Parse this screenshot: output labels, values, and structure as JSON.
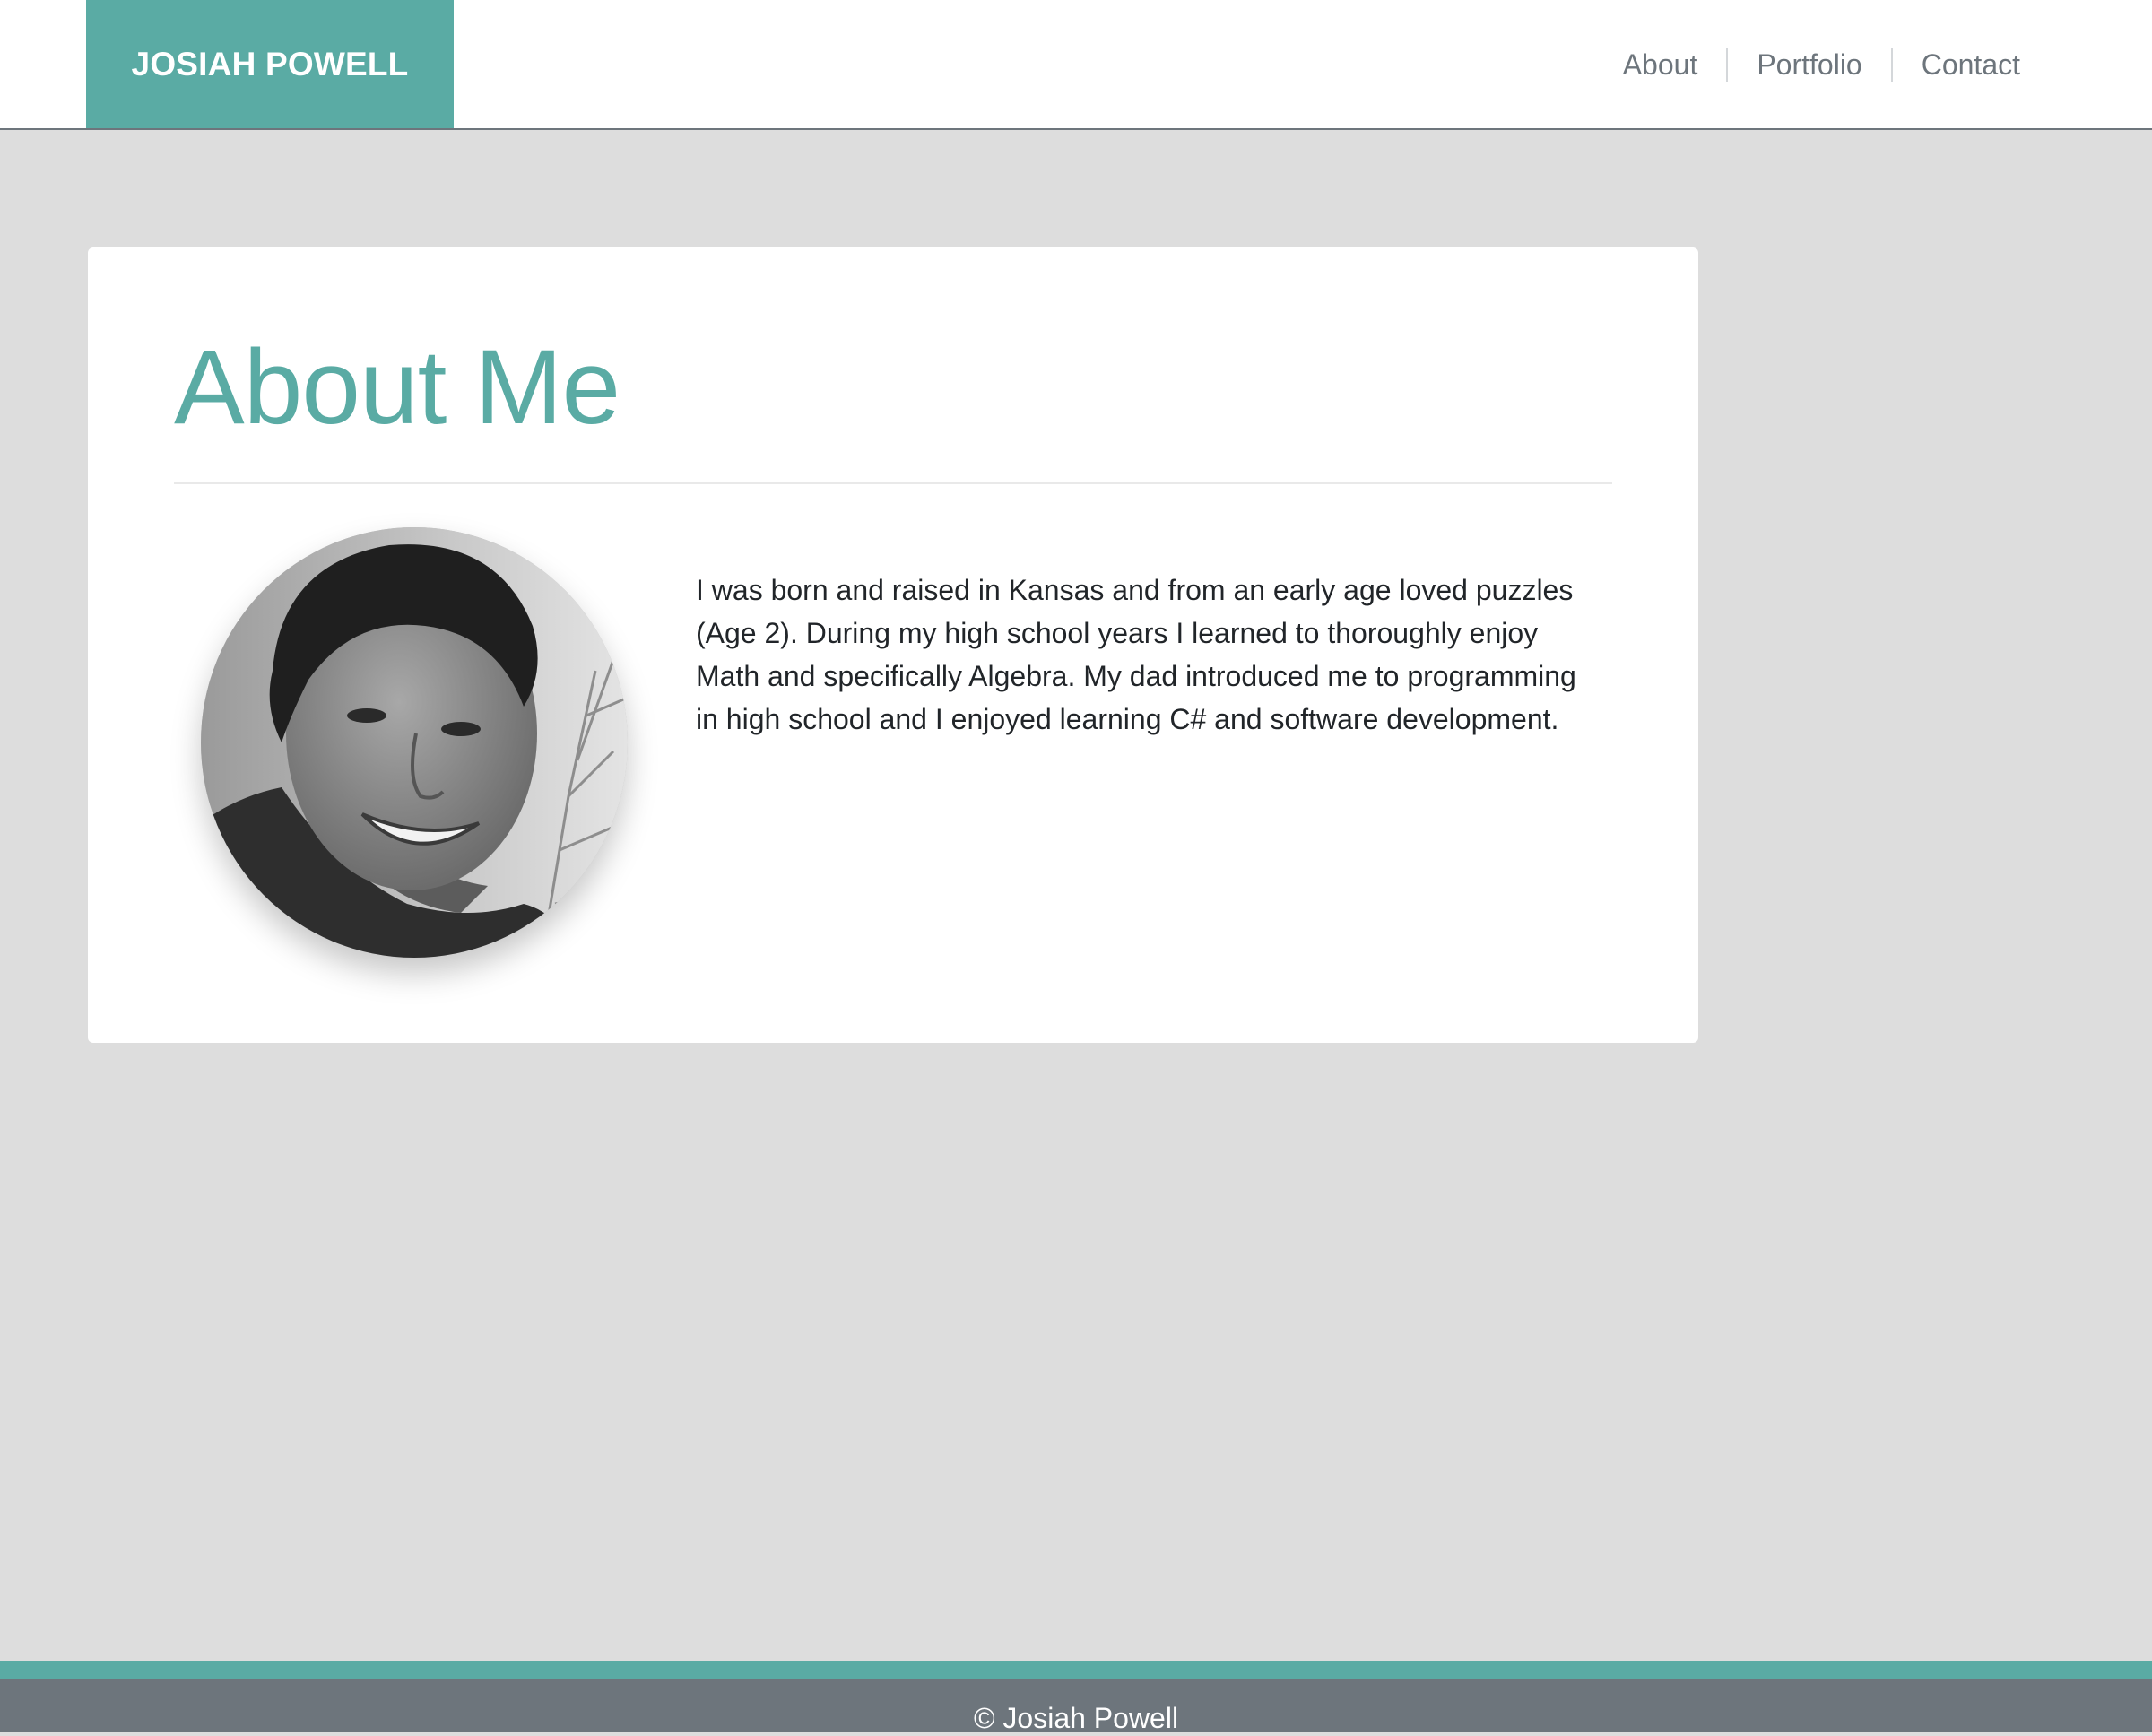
{
  "navbar": {
    "brand": "JOSIAH POWELL",
    "links": [
      {
        "label": "About"
      },
      {
        "label": "Portfolio"
      },
      {
        "label": "Contact"
      }
    ]
  },
  "about": {
    "title": "About Me",
    "bio": "I was born and raised in Kansas and from an early age loved puzzles (Age 2). During my high school years I learned to thoroughly enjoy Math and specifically Algebra. My dad introduced me to programming in high school and I enjoyed learning C# and software development."
  },
  "footer": {
    "copyright": "© Josiah Powell"
  },
  "colors": {
    "accent": "#5aaba4",
    "navbar_bg": "#ffffff",
    "page_bg": "#dddddd",
    "footer_bg": "#6d757c",
    "nav_link": "#6d757c",
    "body_text": "#212529"
  }
}
